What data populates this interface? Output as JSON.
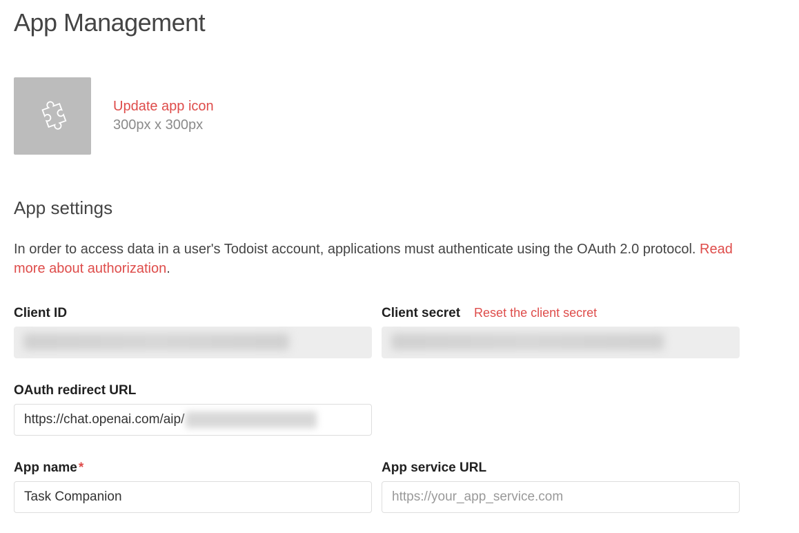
{
  "page": {
    "title": "App Management"
  },
  "icon": {
    "update_link": "Update app icon",
    "dimensions": "300px x 300px"
  },
  "settings": {
    "title": "App settings",
    "description_pre": "In order to access data in a user's Todoist account, applications must authenticate using the OAuth 2.0 protocol. ",
    "auth_link": "Read more about authorization",
    "description_post": "."
  },
  "fields": {
    "client_id": {
      "label": "Client ID",
      "value_redacted": true
    },
    "client_secret": {
      "label": "Client secret",
      "reset_link": "Reset the client secret",
      "value_redacted": true
    },
    "oauth_redirect": {
      "label": "OAuth redirect URL",
      "value_visible": "https://chat.openai.com/aip/",
      "value_rest_redacted": true
    },
    "app_name": {
      "label": "App name",
      "required": true,
      "value": "Task Companion"
    },
    "app_service_url": {
      "label": "App service URL",
      "placeholder": "https://your_app_service.com",
      "value": ""
    }
  }
}
